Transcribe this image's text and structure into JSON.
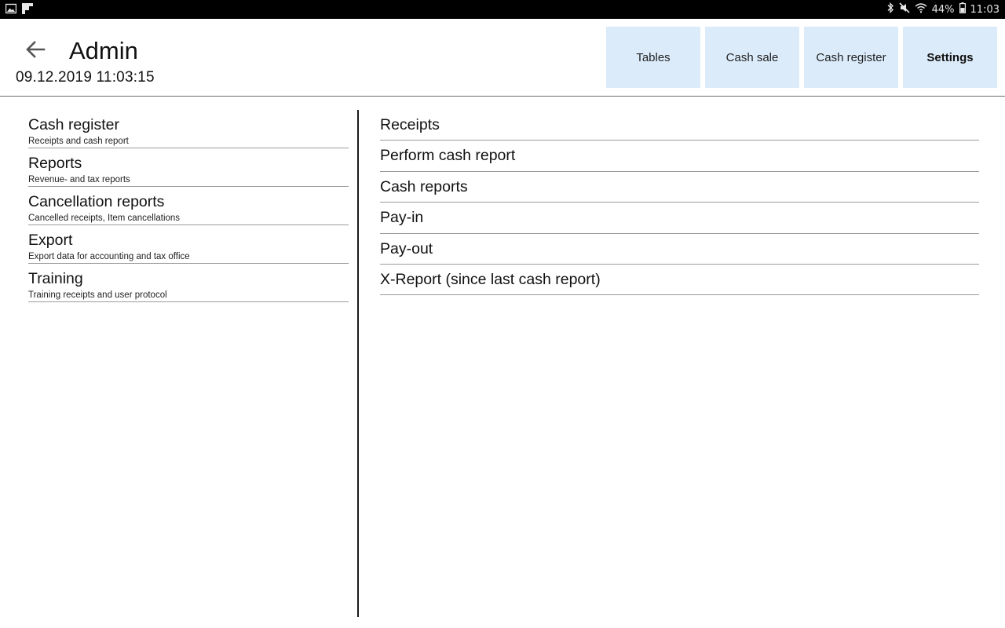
{
  "status_bar": {
    "left_icons": [
      "gallery-icon",
      "flipboard-icon"
    ],
    "right_icons": [
      "bluetooth-icon",
      "mute-icon",
      "wifi-icon"
    ],
    "battery": "44%",
    "battery_icon": "battery-icon",
    "time": "11:03"
  },
  "header": {
    "back_icon": "arrow-back-icon",
    "title": "Admin",
    "datetime": "09.12.2019 11:03:15"
  },
  "nav": [
    {
      "label": "Tables",
      "active": false
    },
    {
      "label": "Cash sale",
      "active": false
    },
    {
      "label": "Cash register",
      "active": false
    },
    {
      "label": "Settings",
      "active": true
    }
  ],
  "left_menu": [
    {
      "title": "Cash register",
      "subtitle": "Receipts and cash report"
    },
    {
      "title": "Reports",
      "subtitle": "Revenue- and tax reports"
    },
    {
      "title": "Cancellation reports",
      "subtitle": "Cancelled receipts, Item cancellations"
    },
    {
      "title": "Export",
      "subtitle": "Export data for accounting and tax office"
    },
    {
      "title": "Training",
      "subtitle": "Training receipts and user protocol"
    }
  ],
  "right_list": [
    "Receipts",
    "Perform cash report",
    "Cash reports",
    "Pay-in",
    "Pay-out",
    "X-Report (since last cash report)"
  ],
  "colors": {
    "nav_button_bg": "#dcebfa",
    "status_bar_bg": "#000000",
    "divider": "#9a9a9a"
  }
}
